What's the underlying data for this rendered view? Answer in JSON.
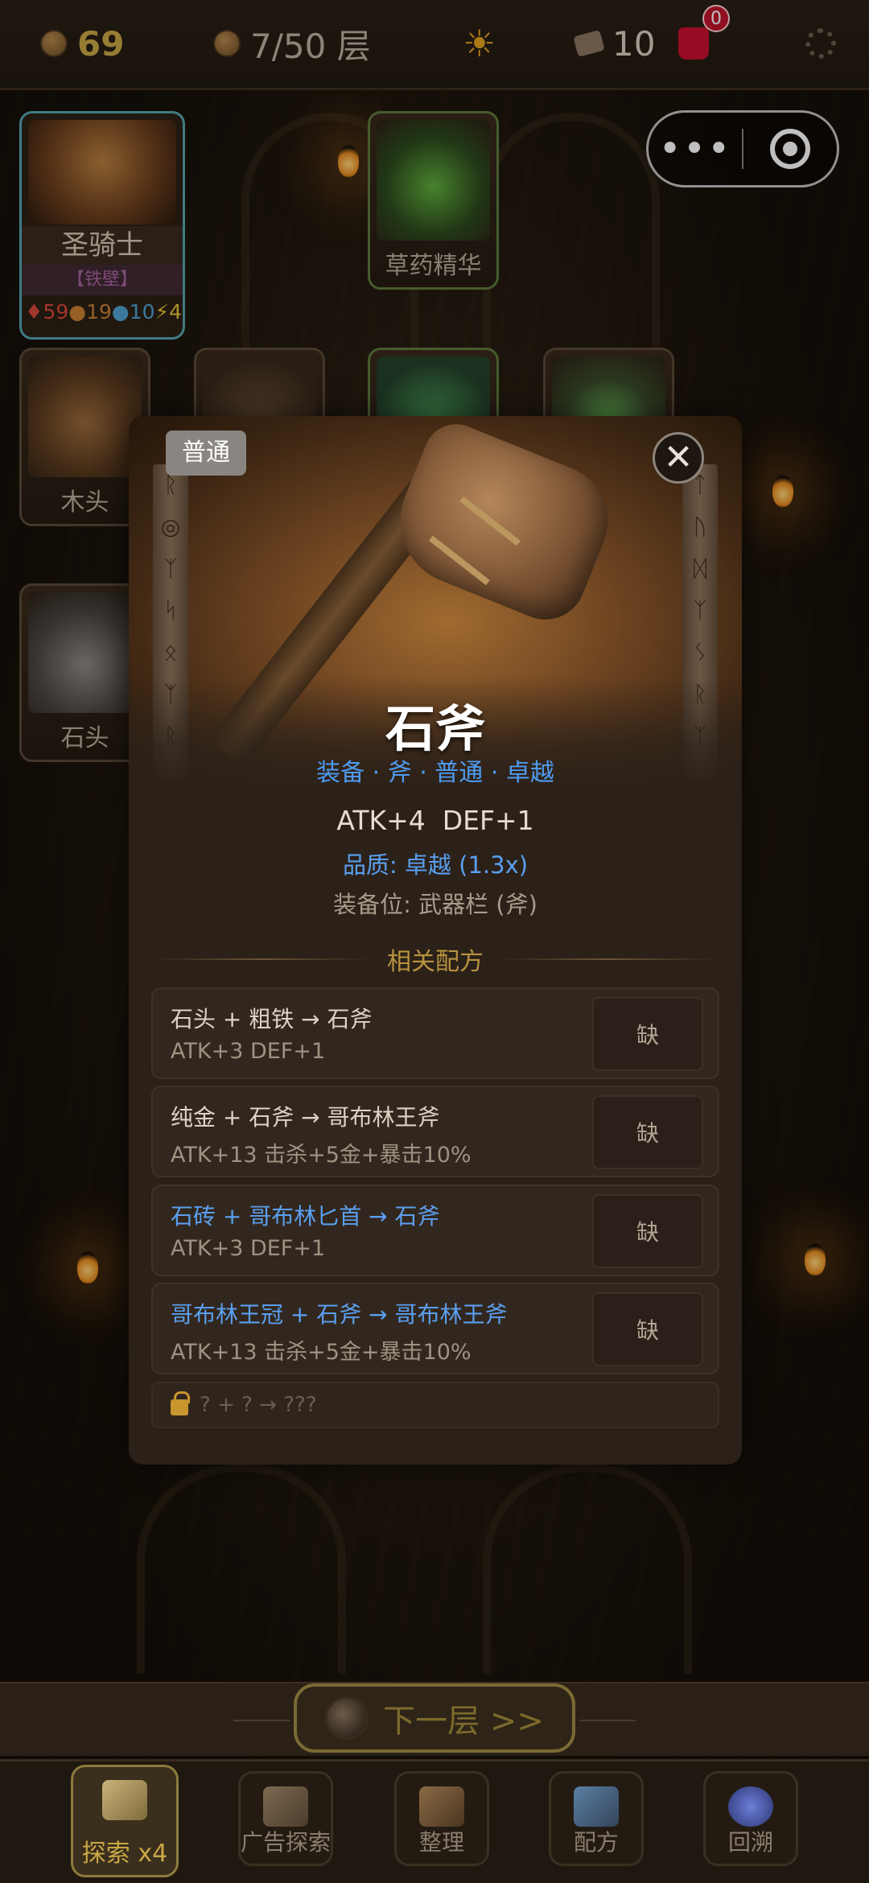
{
  "top_bar": {
    "gold": "69",
    "floor": "7/50 层",
    "tickets": "10",
    "bag_badge": "0"
  },
  "board": {
    "hero": {
      "name": "圣骑士",
      "tag": "【铁壁】",
      "hp": "59",
      "atk": "19",
      "def": "10",
      "spd": "4"
    },
    "cards": [
      {
        "label": "草药精华"
      },
      {
        "label": "木头"
      },
      {
        "label": "石头"
      }
    ]
  },
  "modal": {
    "rarity_badge": "普通",
    "title": "石斧",
    "subtitle": "装备 · 斧 · 普通 · 卓越",
    "stats": "ATK+4  DEF+1",
    "quality": "品质: 卓越 (1.3x)",
    "slot": "装备位: 武器栏 (斧)",
    "section_title": "相关配方",
    "recipes": [
      {
        "formula": "石头 + 粗铁 → 石斧",
        "effect": "ATK+3 DEF+1",
        "button": "缺"
      },
      {
        "formula": "纯金 + 石斧 → 哥布林王斧",
        "effect": "ATK+13 击杀+5金+暴击10%",
        "button": "缺"
      },
      {
        "formula": "石砖 + 哥布林匕首 → 石斧",
        "effect": "ATK+3 DEF+1",
        "button": "缺"
      },
      {
        "formula": "哥布林王冠 + 石斧 → 哥布林王斧",
        "effect": "ATK+13 击杀+5金+暴击10%",
        "button": "缺"
      }
    ],
    "locked_recipe": "? + ? → ???"
  },
  "next_floor": {
    "label": "下一层 >>"
  },
  "bottom_nav": [
    {
      "label": "探索 x4"
    },
    {
      "label": "广告探索"
    },
    {
      "label": "整理"
    },
    {
      "label": "配方"
    },
    {
      "label": "回溯"
    }
  ],
  "colors": {
    "accent_gold": "#c9a745",
    "link_blue": "#5a9ff0",
    "hero_border": "#57a5b0",
    "badge_red": "#c0142c"
  }
}
